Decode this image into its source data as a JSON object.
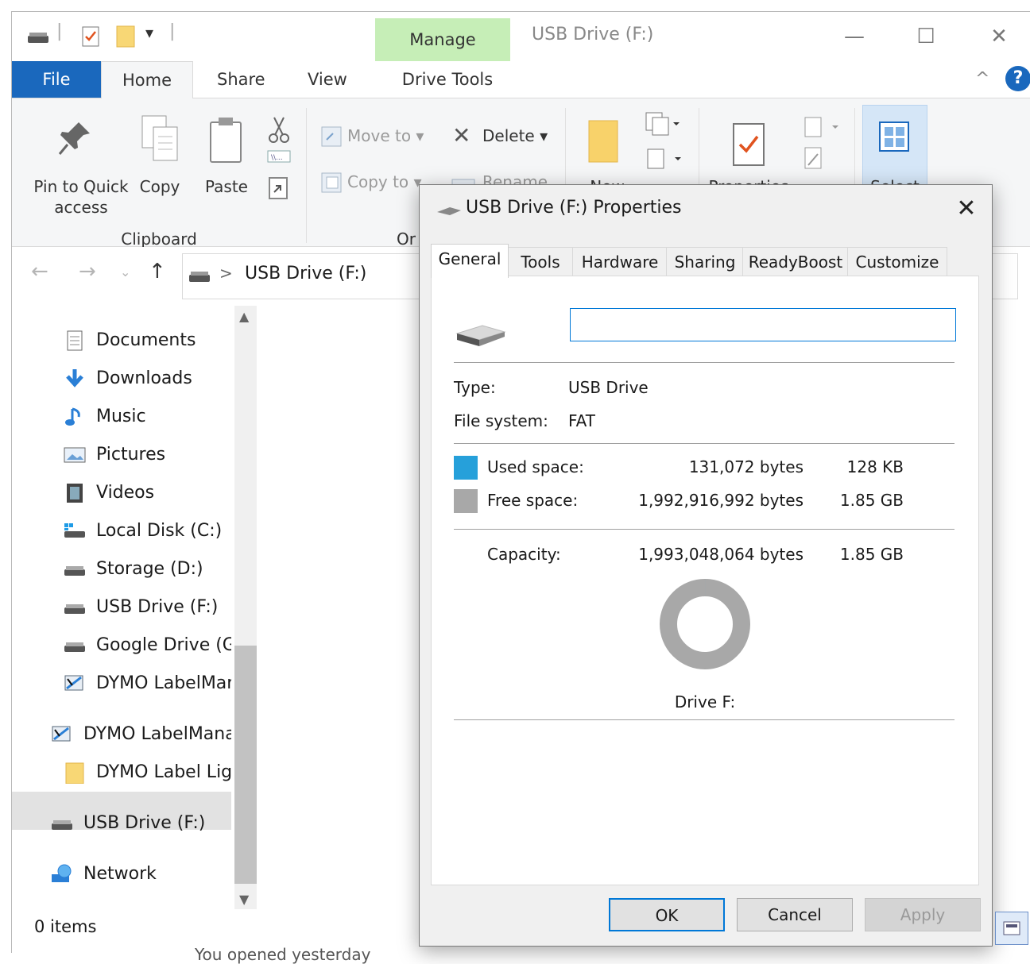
{
  "explorer": {
    "quick_access_toolbar": {
      "dropdown_glyph": "▾"
    },
    "contextual_tab": "Manage",
    "window_title": "USB Drive (F:)",
    "window_controls": {
      "minimize": "—",
      "maximize": "☐",
      "close": "✕"
    },
    "ribbon_tabs": {
      "file": "File",
      "home": "Home",
      "share": "Share",
      "view": "View",
      "drive_tools": "Drive Tools"
    },
    "ribbon_right": {
      "collapse": "^",
      "help": "?"
    },
    "clipboard": {
      "pin_label_1": "Pin to Quick",
      "pin_label_2": "access",
      "copy": "Copy",
      "paste": "Paste",
      "group": "Clipboard"
    },
    "organize": {
      "move_to": "Move to",
      "copy_to": "Copy to",
      "delete": "Delete",
      "rename": "Rename",
      "group_partial": "Or"
    },
    "new": {
      "label": "New"
    },
    "open": {
      "properties": "Properties"
    },
    "select": {
      "label": "Select"
    },
    "address": {
      "path": "USB Drive (F:)",
      "separator": ">"
    },
    "nav_items": [
      {
        "label": "Documents",
        "icon": "documents-icon"
      },
      {
        "label": "Downloads",
        "icon": "downloads-icon"
      },
      {
        "label": "Music",
        "icon": "music-icon"
      },
      {
        "label": "Pictures",
        "icon": "pictures-icon"
      },
      {
        "label": "Videos",
        "icon": "videos-icon"
      },
      {
        "label": "Local Disk (C:)",
        "icon": "local-disk-icon"
      },
      {
        "label": "Storage (D:)",
        "icon": "drive-icon"
      },
      {
        "label": "USB Drive (F:)",
        "icon": "drive-icon"
      },
      {
        "label": "Google Drive (G:",
        "icon": "drive-icon"
      },
      {
        "label": "DYMO LabelMar",
        "icon": "dymo-icon"
      },
      {
        "label": "DYMO LabelMana",
        "icon": "dymo-icon"
      },
      {
        "label": "DYMO Label Lig",
        "icon": "folder-icon"
      },
      {
        "label": "USB Drive (F:)",
        "icon": "drive-icon"
      },
      {
        "label": "Network",
        "icon": "network-icon"
      }
    ],
    "status": "0 items",
    "bottom_note": "You opened yesterday"
  },
  "dialog": {
    "title": "USB Drive (F:) Properties",
    "close": "✕",
    "tabs": [
      "General",
      "Tools",
      "Hardware",
      "Sharing",
      "ReadyBoost",
      "Customize"
    ],
    "selected_tab": "General",
    "volume_name_value": "",
    "type_label": "Type:",
    "type_value": "USB Drive",
    "fs_label": "File system:",
    "fs_value": "FAT",
    "used_label": "Used space:",
    "used_bytes": "131,072 bytes",
    "used_short": "128 KB",
    "free_label": "Free space:",
    "free_bytes": "1,992,916,992 bytes",
    "free_short": "1.85 GB",
    "capacity_label": "Capacity:",
    "capacity_bytes": "1,993,048,064 bytes",
    "capacity_short": "1.85 GB",
    "used_fraction": 6.58e-05,
    "drive_caption": "Drive F:",
    "colors": {
      "used": "#26a0da",
      "free": "#a8a8a8"
    },
    "buttons": {
      "ok": "OK",
      "cancel": "Cancel",
      "apply": "Apply"
    }
  }
}
